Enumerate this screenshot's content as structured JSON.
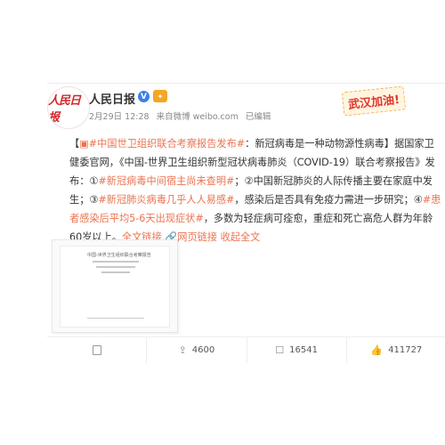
{
  "post": {
    "username": "人民日报",
    "vip_label": "V",
    "meta": {
      "time": "2月29日 12:28",
      "source": "来自微博 weibo.com",
      "edited": "已编辑"
    },
    "sticker": "武汉加油!",
    "avatar_text": "人民日报",
    "body": {
      "bracket_open": "【",
      "topic_main": "#中国世卫组织联合考察报告发布#",
      "after_topic": "：新冠病毒是一种动物源性病毒",
      "bracket_close": "】",
      "intro": "据国家卫健委官网，《中国-世界卫生组织新型冠状病毒肺炎（COVID-19）联合考察报告》发布：①",
      "tag1": "#新冠病毒中间宿主尚未查明#",
      "part2": "；②中国新冠肺炎的人际传播主要在家庭中发生；③",
      "tag2": "#新冠肺炎病毒几乎人人易感#",
      "part3": "，感染后是否具有免疫力需进一步研究；④",
      "tag3": "#患者感染后平均5-6天出现症状#",
      "part4": "，多数为轻症病可痊愈，重症和死亡高危人群为年龄60岁以上。",
      "full_text_link": "全文链接",
      "web_link": "网页链接",
      "collapse": "收起全文"
    },
    "thumbnail": {
      "title": "中国-世界卫生组织联合考察报告"
    },
    "actions": {
      "share_count": "4600",
      "comment_count": "16541",
      "like_count": "411727"
    }
  },
  "colors": {
    "link": "#eb7350",
    "brand_red": "#d3262b",
    "verified_blue": "#3a7fe6"
  }
}
